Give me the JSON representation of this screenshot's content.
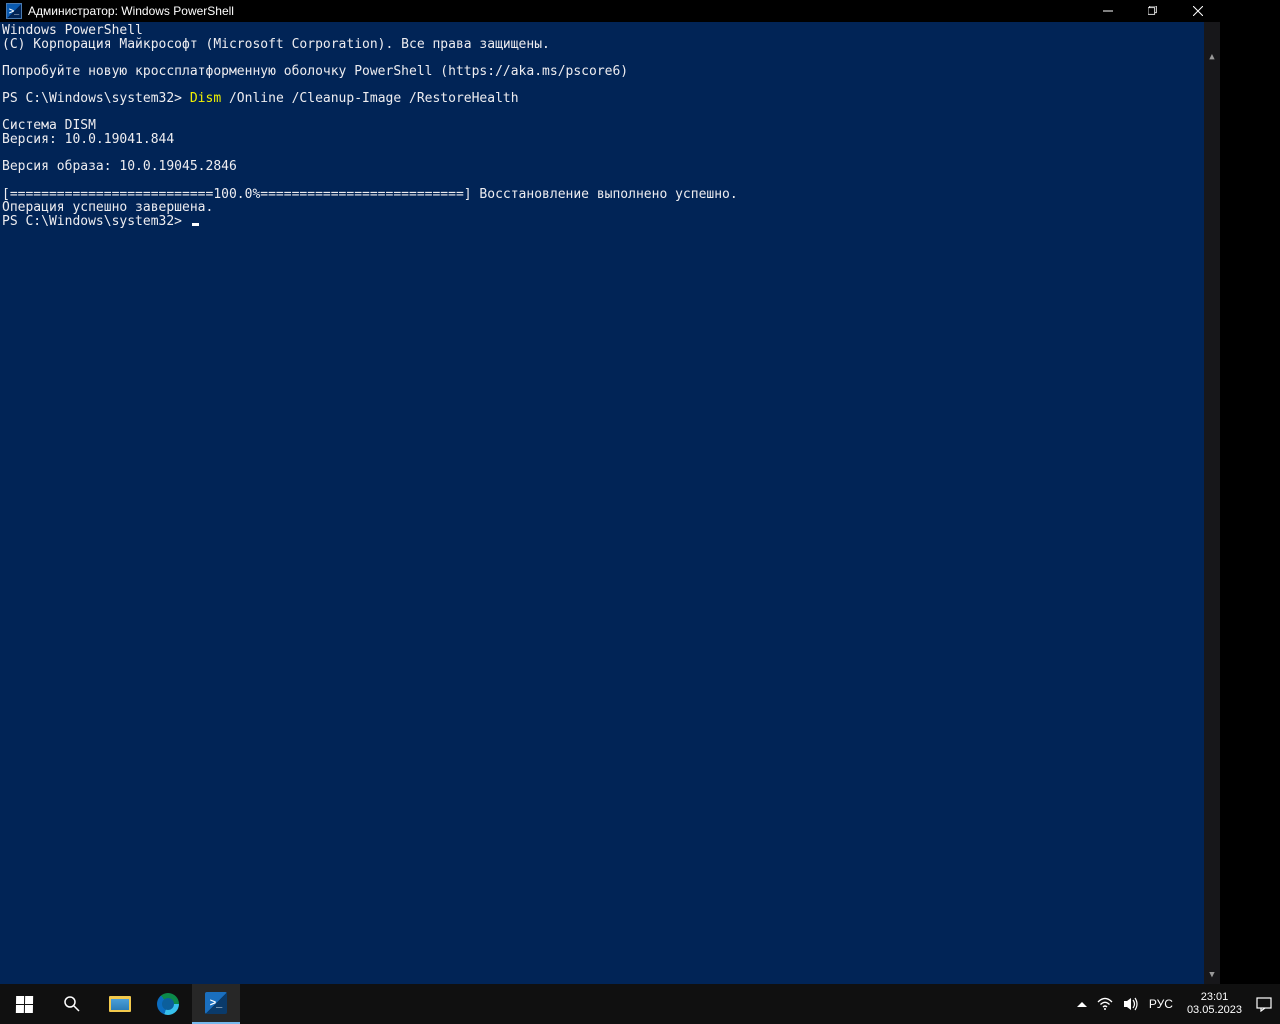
{
  "titlebar": {
    "title": "Администратор: Windows PowerShell"
  },
  "terminal": {
    "header1": "Windows PowerShell",
    "header2": "(C) Корпорация Майкрософт (Microsoft Corporation). Все права защищены.",
    "try_new": "Попробуйте новую кроссплатформенную оболочку PowerShell (https://aka.ms/pscore6)",
    "prompt1_pre": "PS C:\\Windows\\system32> ",
    "prompt1_cmd": "Dism",
    "prompt1_args": " /Online /Cleanup-Image /RestoreHealth",
    "dism_sys": "Система DISM",
    "dism_ver": "Версия: 10.0.19041.844",
    "img_ver": "Версия образа: 10.0.19045.2846",
    "progress": "[==========================100.0%==========================] Восстановление выполнено успешно.",
    "op_done": "Операция успешно завершена.",
    "prompt2": "PS C:\\Windows\\system32> "
  },
  "taskbar": {
    "lang": "РУС",
    "time": "23:01",
    "date": "03.05.2023"
  }
}
